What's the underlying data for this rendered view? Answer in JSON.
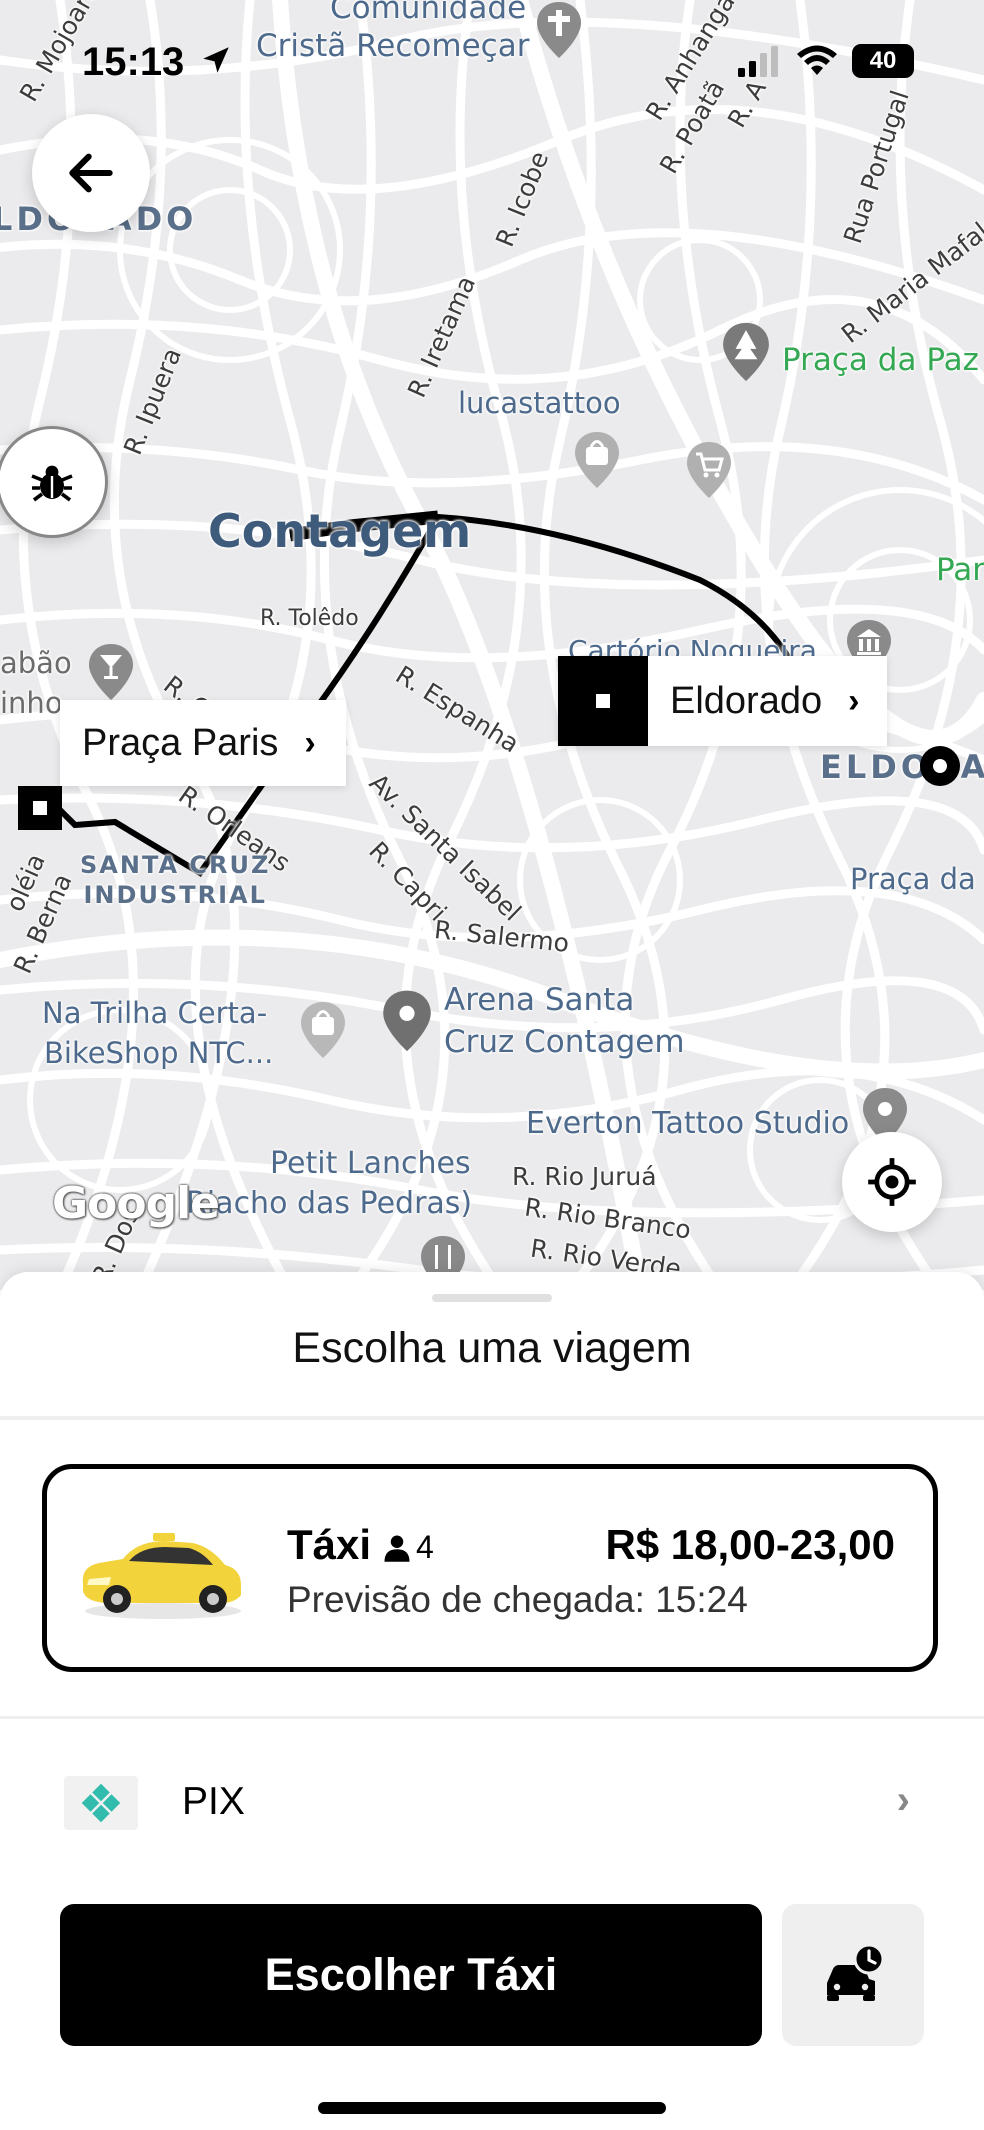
{
  "status_bar": {
    "time": "15:13",
    "battery": "40"
  },
  "map": {
    "labels": {
      "comunidade_1": "Comunidade",
      "comunidade_2": "Cristã Recomeçar",
      "r_mojoara": "R. Mojoara",
      "r_anhanga": "R. Anhangá",
      "r_poata": "R. Poatã",
      "r_a": "R. A",
      "eldorado_top": "LDORADO",
      "r_icobe": "R. Icobe",
      "rua_portugal": "Rua Portugal",
      "r_maria_mafalda": "R. Maria Mafalda",
      "praca_da_paz": "Praça da Paz",
      "r_iretama": "R. Iretama",
      "r_ipuera": "R. Ipuera",
      "lucastattoo": "lucastattoo",
      "contagem": "Contagem",
      "par": "Par",
      "r_toledo": "R. Tolêdo",
      "abao": "abão",
      "inho": "inho",
      "r_cor": "R. Cór",
      "cartorio": "Cartório Nogueira",
      "r_espanha": "R. Espanha",
      "eldorado_right": "ELDORADO",
      "orleans": "R. Orleans",
      "av_santa_isabel": "Av. Santa Isabel",
      "r_capri": "R. Capri",
      "santa_cruz_1": "SANTA CRUZ",
      "santa_cruz_2": "INDUSTRIAL",
      "praca_da": "Praça da",
      "r_salermo": "R. Salermo",
      "r_berna": "R. Berna",
      "oleia": "oléia",
      "na_trilha_1": "Na Trilha Certa-",
      "na_trilha_2": "BikeShop NTC...",
      "arena_1": "Arena Santa",
      "arena_2": "Cruz Contagem",
      "everton": "Everton Tattoo Studio",
      "petit_1": "Petit Lanches",
      "petit_2": "Riacho das Pedras)",
      "r_rio_jurua": "R. Rio Juruá",
      "r_rio_branco": "R. Rio Branco",
      "r_rio_verde": "R. Rio Verde",
      "r_dos": "R. Dos",
      "google": "Google"
    },
    "origin_label": "Praça Paris",
    "destination_label": "Eldorado",
    "callout_chevron": "›"
  },
  "sheet": {
    "title": "Escolha uma viagem",
    "ride": {
      "name": "Táxi",
      "seats": "4",
      "price": "R$ 18,00-23,00",
      "eta": "Previsão de chegada: 15:24"
    },
    "payment": {
      "label": "PIX",
      "chevron": "›"
    },
    "choose_button": "Escolher Táxi"
  },
  "icons": [
    "back-arrow-icon",
    "bug-icon",
    "locate-icon",
    "location-arrow-icon",
    "signal-icon",
    "wifi-icon",
    "pix-icon",
    "schedule-car-icon",
    "cross-pin-icon",
    "tree-pin-icon",
    "shopping-bag-pin-icon",
    "cart-pin-icon",
    "bank-pin-icon",
    "cocktail-pin-icon",
    "place-pin-icon",
    "restaurant-pin-icon",
    "person-icon"
  ],
  "colors": {
    "route": "#000000",
    "map_background": "#ebebed",
    "primary_button": "#000000",
    "pix": "#32bcad",
    "taxi": "#f3d33b"
  }
}
